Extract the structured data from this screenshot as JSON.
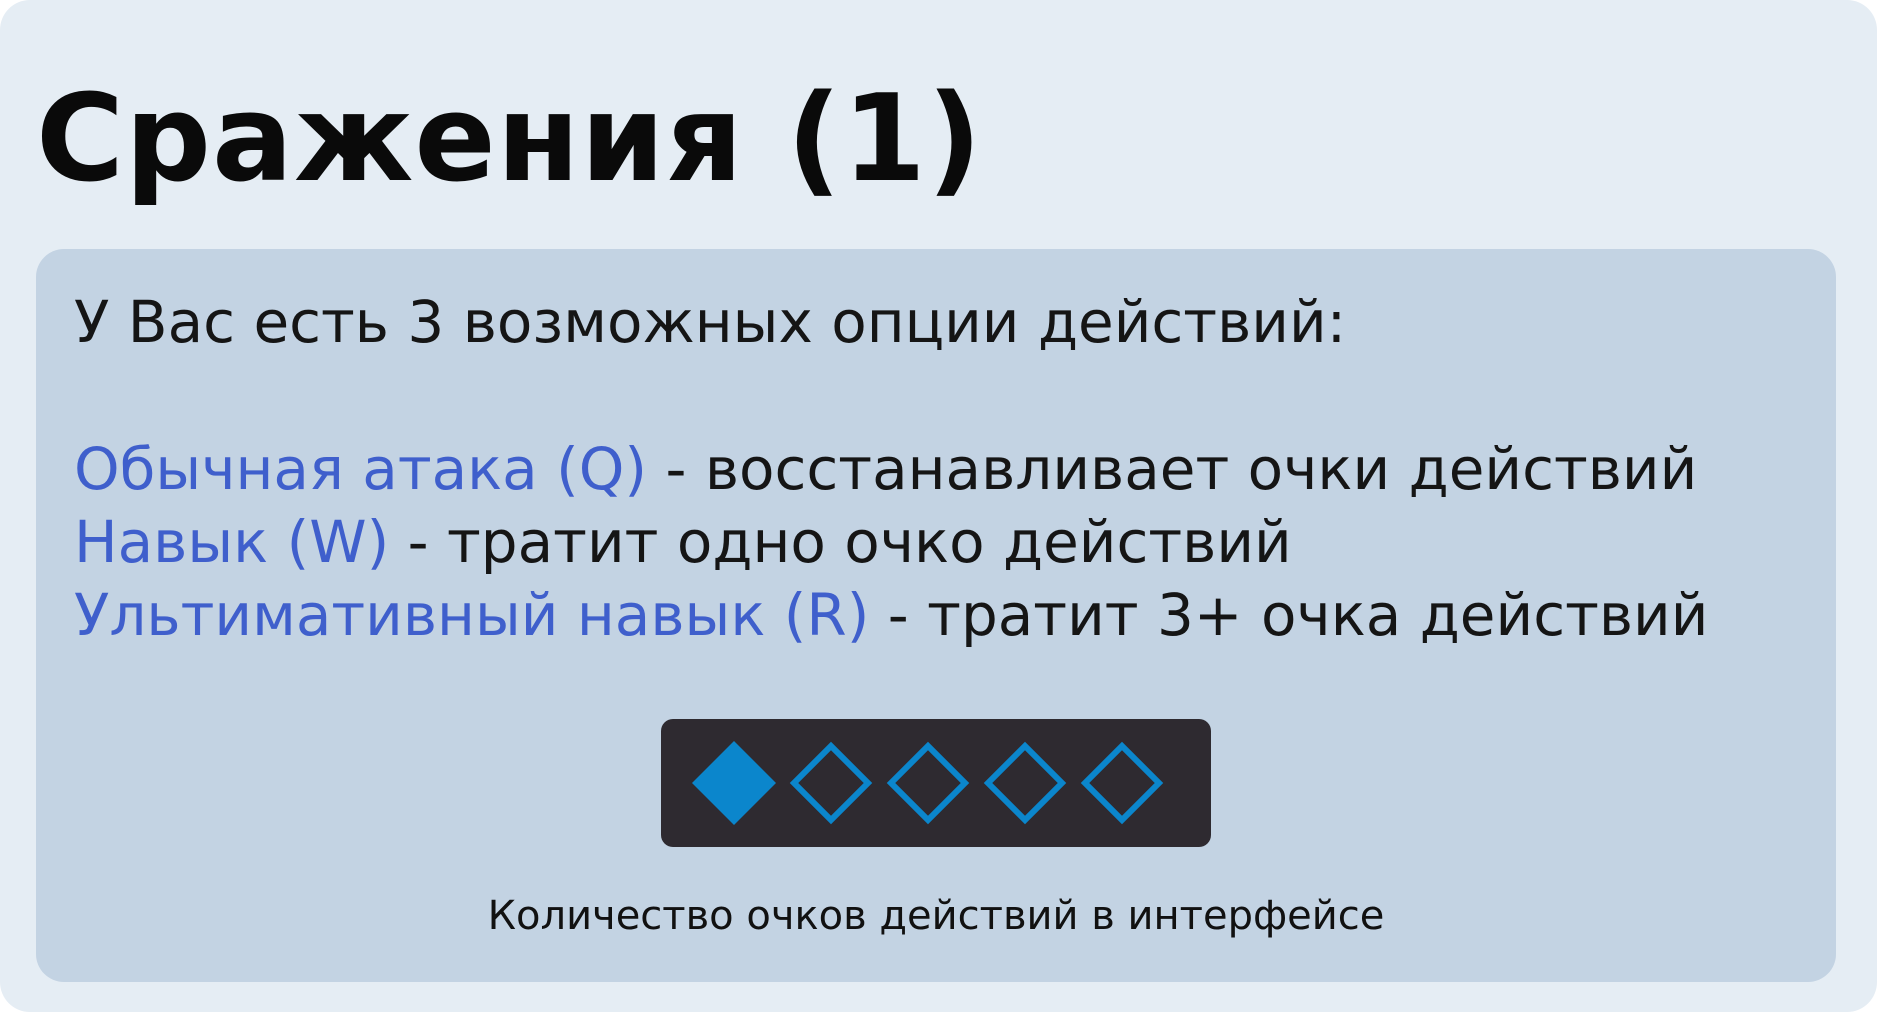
{
  "title": "Сражения (1)",
  "intro": "У Вас есть 3 возможных опции действий:",
  "options": [
    {
      "name": "Обычная атака (Q)",
      "description": " - восстанавливает очки действий"
    },
    {
      "name": "Навык (W)",
      "description": " - тратит одно очко действий"
    },
    {
      "name": "Ультимативный навык (R)",
      "description": " - тратит 3+ очка действий"
    }
  ],
  "action_points": {
    "filled": 1,
    "total": 5
  },
  "caption": "Количество очков действий в интерфейсе",
  "colors": {
    "background": "#e5edf4",
    "panel": "#c3d3e3",
    "option_name": "#3f5fcc",
    "bar": "#2e2a30",
    "diamond": "#0b86cc"
  }
}
